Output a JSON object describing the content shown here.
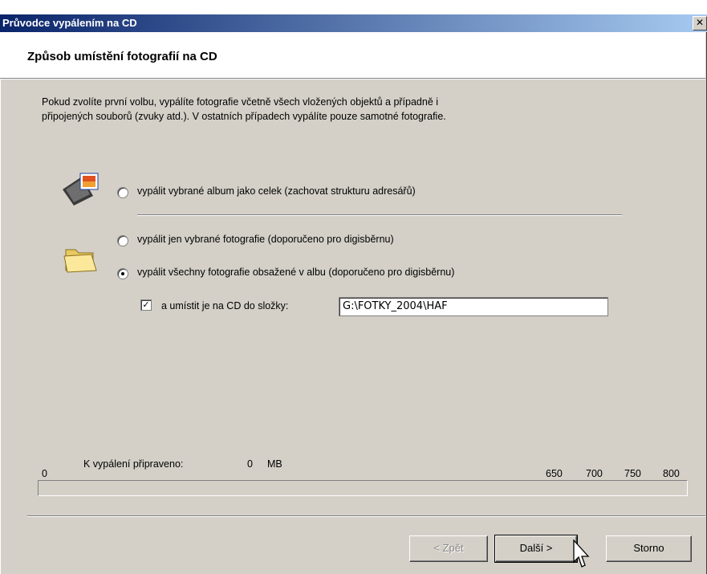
{
  "window": {
    "title": "Průvodce vypálením na CD",
    "close_glyph": "✕"
  },
  "header": {
    "heading": "Způsob umístění fotografií na CD"
  },
  "description": {
    "line1": "Pokud zvolíte první volbu, vypálíte fotografie včetně všech vložených objektů a případně i",
    "line2": "připojených souborů (zvuky atd.). V ostatních případech vypálíte pouze samotné fotografie."
  },
  "options": [
    {
      "label": "vypálit vybrané album jako celek (zachovat strukturu adresářů)",
      "checked": false,
      "icon": "album-icon"
    },
    {
      "label": "vypálit jen vybrané fotografie (doporučeno pro digisběrnu)",
      "checked": false,
      "icon": "folder-icon"
    },
    {
      "label": "vypálit všechny fotografie obsažené v albu (doporučeno pro digisběrnu)",
      "checked": true
    }
  ],
  "folder_option": {
    "label": "a umístit je na CD do složky:",
    "checked": true,
    "check_glyph": "✓",
    "value": "G:\\FOTKY_2004\\HAF"
  },
  "progress": {
    "zero": "0",
    "ready_label": "K vypálení připraveno:",
    "ready_value": "0",
    "unit": "MB",
    "marks": [
      "650",
      "700",
      "750",
      "800"
    ],
    "fill": 0
  },
  "buttons": {
    "back": "< Zpět",
    "next": "Další >",
    "cancel": "Storno"
  }
}
